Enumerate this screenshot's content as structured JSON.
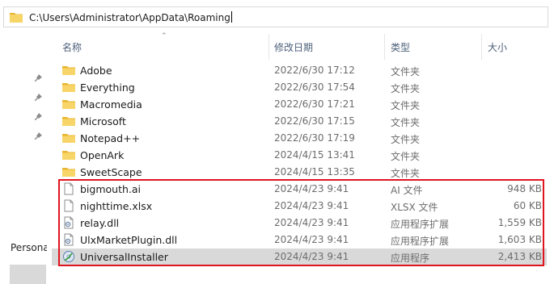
{
  "address": {
    "path": "C:\\Users\\Administrator\\AppData\\Roaming"
  },
  "columns": {
    "name": "名称",
    "modified": "修改日期",
    "type": "类型",
    "size": "大小"
  },
  "nav": {
    "label": "Persona"
  },
  "files": [
    {
      "name": "Adobe",
      "modified": "2022/6/30 17:12",
      "type": "文件夹",
      "size": "",
      "icon": "folder-icon"
    },
    {
      "name": "Everything",
      "modified": "2022/6/30 17:54",
      "type": "文件夹",
      "size": "",
      "icon": "folder-icon"
    },
    {
      "name": "Macromedia",
      "modified": "2022/6/30 17:21",
      "type": "文件夹",
      "size": "",
      "icon": "folder-icon"
    },
    {
      "name": "Microsoft",
      "modified": "2022/6/30 17:15",
      "type": "文件夹",
      "size": "",
      "icon": "folder-icon"
    },
    {
      "name": "Notepad++",
      "modified": "2022/6/30 17:19",
      "type": "文件夹",
      "size": "",
      "icon": "folder-icon"
    },
    {
      "name": "OpenArk",
      "modified": "2024/4/15 13:41",
      "type": "文件夹",
      "size": "",
      "icon": "folder-icon"
    },
    {
      "name": "SweetScape",
      "modified": "2024/4/15 13:35",
      "type": "文件夹",
      "size": "",
      "icon": "folder-icon"
    },
    {
      "name": "bigmouth.ai",
      "modified": "2024/4/23 9:41",
      "type": "AI 文件",
      "size": "948 KB",
      "icon": "file-icon"
    },
    {
      "name": "nighttime.xlsx",
      "modified": "2024/4/23 9:41",
      "type": "XLSX 文件",
      "size": "60 KB",
      "icon": "file-icon"
    },
    {
      "name": "relay.dll",
      "modified": "2024/4/23 9:41",
      "type": "应用程序扩展",
      "size": "1,559 KB",
      "icon": "dll-icon"
    },
    {
      "name": "UlxMarketPlugin.dll",
      "modified": "2024/4/23 9:41",
      "type": "应用程序扩展",
      "size": "1,603 KB",
      "icon": "dll-icon"
    },
    {
      "name": "UniversalInstaller",
      "modified": "2024/4/23 9:41",
      "type": "应用程序",
      "size": "2,413 KB",
      "icon": "installer-icon",
      "selected": true
    }
  ],
  "colors": {
    "highlight_box": "#e0141e",
    "folder": "#f4c842",
    "selected_row": "#d9d9d9"
  }
}
